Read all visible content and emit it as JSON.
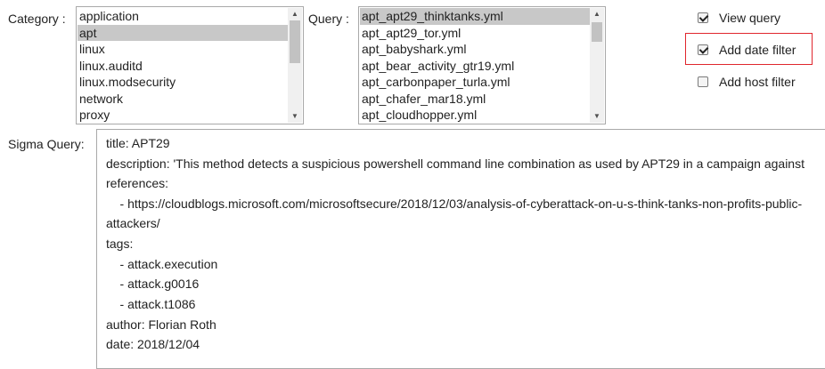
{
  "category": {
    "label": "Category :",
    "options": [
      "application",
      "apt",
      "linux",
      "linux.auditd",
      "linux.modsecurity",
      "network",
      "proxy"
    ],
    "selected": "apt"
  },
  "query": {
    "label": "Query :",
    "options": [
      "apt_apt29_thinktanks.yml",
      "apt_apt29_tor.yml",
      "apt_babyshark.yml",
      "apt_bear_activity_gtr19.yml",
      "apt_carbonpaper_turla.yml",
      "apt_chafer_mar18.yml",
      "apt_cloudhopper.yml"
    ],
    "selected": "apt_apt29_thinktanks.yml"
  },
  "options": {
    "view_query": {
      "label": "View query",
      "checked": true
    },
    "add_date_filter": {
      "label": "Add date filter",
      "checked": true,
      "highlight_color": "#e0262d"
    },
    "add_host_filter": {
      "label": "Add host filter",
      "checked": false
    }
  },
  "sigma": {
    "label": "Sigma Query:",
    "lines": [
      "title: APT29",
      "description: 'This method detects a suspicious powershell command line combination as used by APT29 in a campaign against",
      "references:",
      "    - https://cloudblogs.microsoft.com/microsoftsecure/2018/12/03/analysis-of-cyberattack-on-u-s-think-tanks-non-profits-public-",
      "attackers/",
      "tags:",
      "    - attack.execution",
      "    - attack.g0016",
      "    - attack.t1086",
      "author: Florian Roth",
      "date: 2018/12/04"
    ]
  }
}
